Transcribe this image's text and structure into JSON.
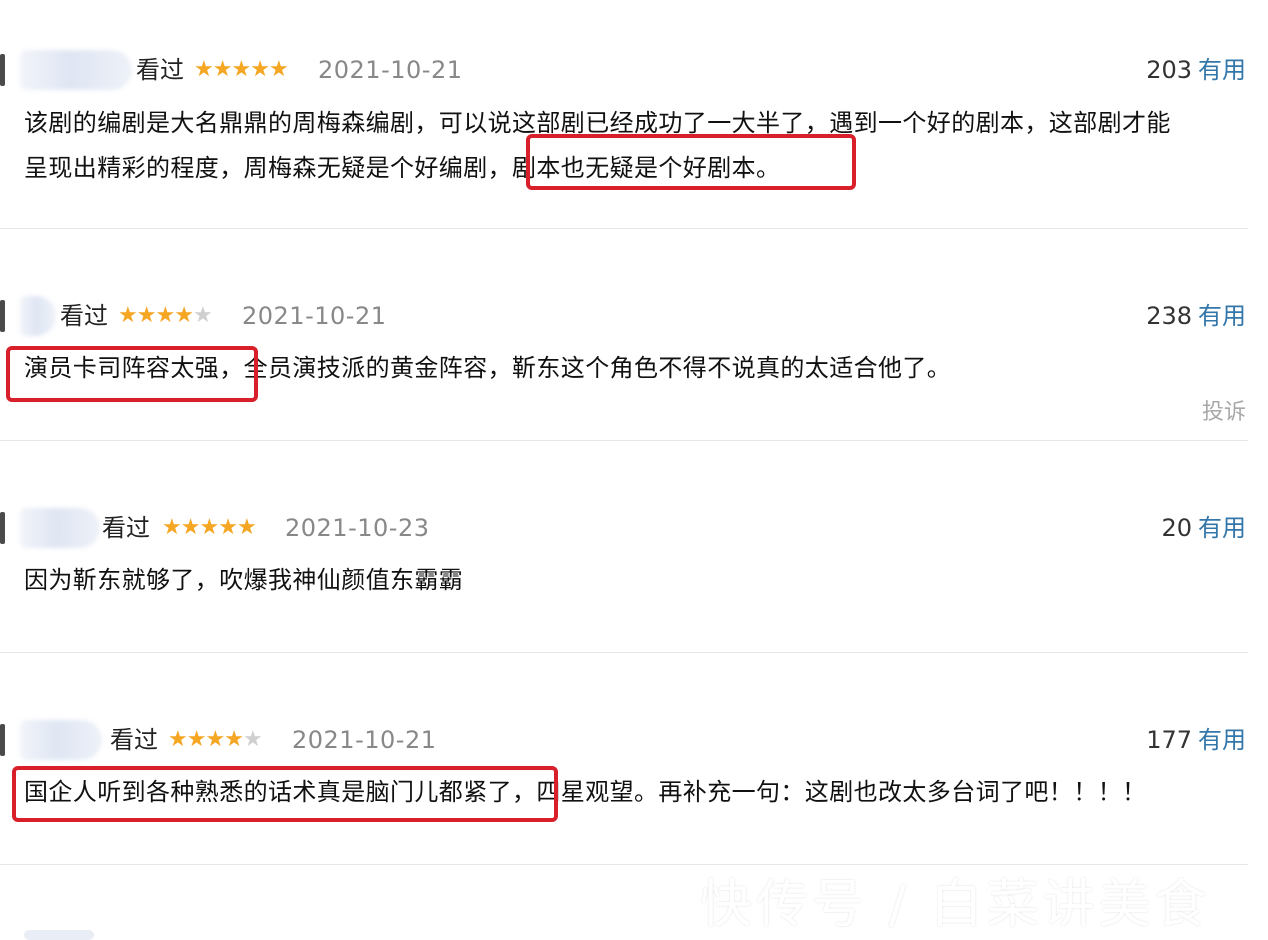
{
  "reviews": [
    {
      "status": "看过",
      "stars": [
        "★",
        "★",
        "★",
        "★",
        "★"
      ],
      "date": "2021-10-21",
      "votes": "203",
      "useful_label": "有用",
      "line1": "该剧的编剧是大名鼎鼎的周梅森编剧，可以说这部剧已经成功了一大半了，遇到一个好的剧本，这部剧才能",
      "line2_pre": "呈现出精彩的程度，周梅森无疑是个好编剧，",
      "line2_hl": "剧本也无疑是个好剧本。"
    },
    {
      "status": "看过",
      "stars": [
        "★",
        "★",
        "★",
        "★",
        "★"
      ],
      "stars_on": 4,
      "date": "2021-10-21",
      "votes": "238",
      "useful_label": "有用",
      "line1_hl": "演员卡司阵容太强，",
      "line1_post": "全员演技派的黄金阵容，靳东这个角色不得不说真的太适合他了。",
      "report_label": "投诉"
    },
    {
      "status": "看过",
      "stars": [
        "★",
        "★",
        "★",
        "★",
        "★"
      ],
      "date": "2021-10-23",
      "votes": "20",
      "useful_label": "有用",
      "line1": "因为靳东就够了，吹爆我神仙颜值东霸霸"
    },
    {
      "status": "看过",
      "stars": [
        "★",
        "★",
        "★",
        "★",
        "★"
      ],
      "stars_on": 4,
      "date": "2021-10-21",
      "votes": "177",
      "useful_label": "有用",
      "line1_hl": "国企人听到各种熟悉的话术真是脑门儿都紧了，",
      "line1_post": "四星观望。再补充一句：这剧也改太多台词了吧！！！！"
    }
  ],
  "watermark": "快传号 / 白菜讲美食",
  "colors": {
    "star": "#f5a623",
    "useful": "#3377aa",
    "highlight": "#d9202a"
  }
}
